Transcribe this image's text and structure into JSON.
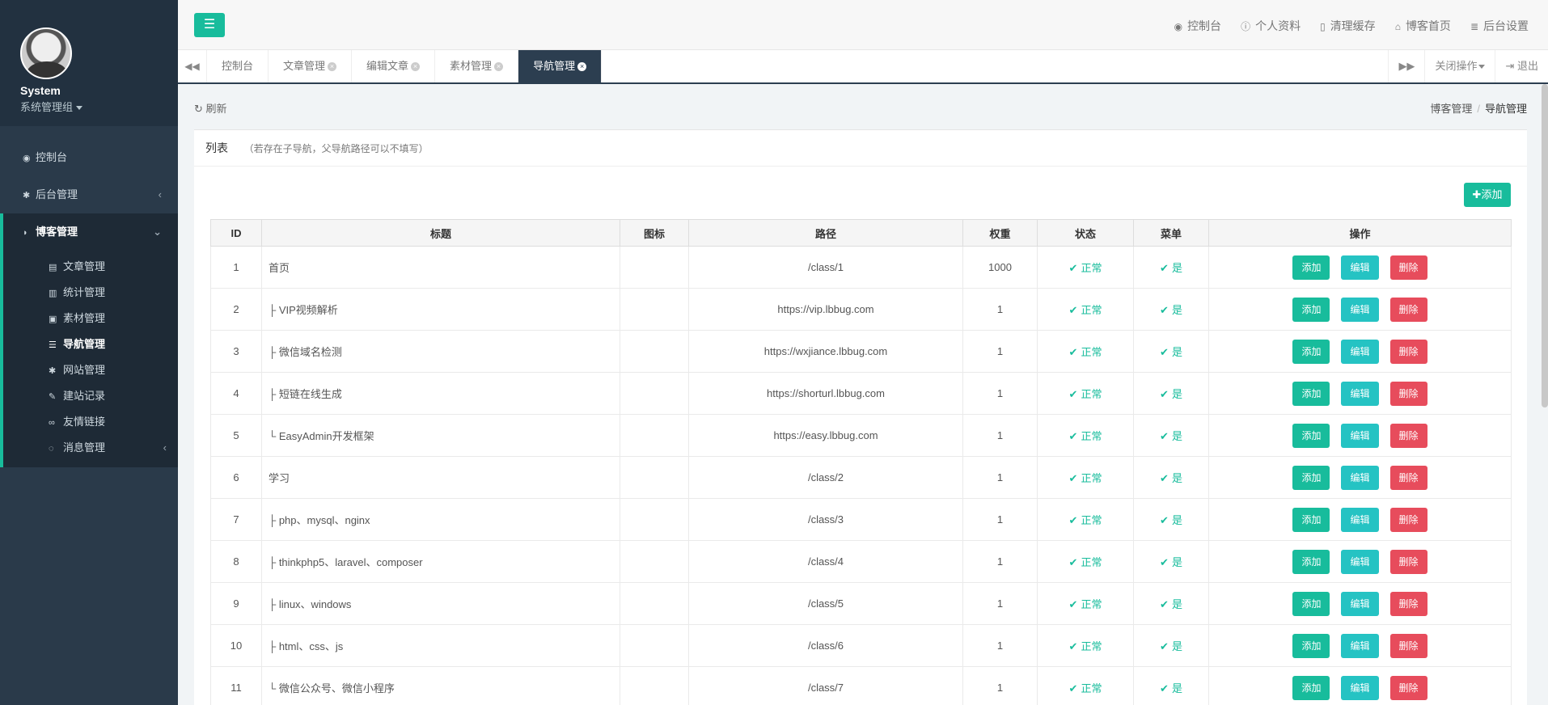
{
  "user": {
    "name": "System",
    "group": "系统管理组"
  },
  "menu": {
    "dashboard": "控制台",
    "admin": "后台管理",
    "blog": "博客管理",
    "sub": [
      "文章管理",
      "统计管理",
      "素材管理",
      "导航管理",
      "网站管理",
      "建站记录",
      "友情链接",
      "消息管理"
    ]
  },
  "header": {
    "links": [
      "控制台",
      "个人资料",
      "清理缓存",
      "博客首页",
      "后台设置"
    ]
  },
  "tabs": [
    "控制台",
    "文章管理",
    "编辑文章",
    "素材管理",
    "导航管理"
  ],
  "tabbar_right": {
    "close_ops": "关闭操作",
    "logout": "退出"
  },
  "content": {
    "refresh": "刷新",
    "breadcrumb": [
      "博客管理",
      "导航管理"
    ],
    "panel_title": "列表",
    "panel_note": "（若存在子导航，父导航路径可以不填写）",
    "add_button": "添加"
  },
  "table": {
    "columns": [
      "ID",
      "标题",
      "图标",
      "路径",
      "权重",
      "状态",
      "菜单",
      "操作"
    ],
    "actions": {
      "add": "添加",
      "edit": "编辑",
      "delete": "删除"
    },
    "rows": [
      {
        "id": "1",
        "title": "首页",
        "icon": "",
        "path": "/class/1",
        "weight": "1000",
        "status": "正常",
        "menu": "是"
      },
      {
        "id": "2",
        "title": "├ VIP视频解析",
        "icon": "",
        "path": "https://vip.lbbug.com",
        "weight": "1",
        "status": "正常",
        "menu": "是"
      },
      {
        "id": "3",
        "title": "├ 微信域名检测",
        "icon": "",
        "path": "https://wxjiance.lbbug.com",
        "weight": "1",
        "status": "正常",
        "menu": "是"
      },
      {
        "id": "4",
        "title": "├ 短链在线生成",
        "icon": "",
        "path": "https://shorturl.lbbug.com",
        "weight": "1",
        "status": "正常",
        "menu": "是"
      },
      {
        "id": "5",
        "title": "└ EasyAdmin开发框架",
        "icon": "",
        "path": "https://easy.lbbug.com",
        "weight": "1",
        "status": "正常",
        "menu": "是"
      },
      {
        "id": "6",
        "title": "学习",
        "icon": "",
        "path": "/class/2",
        "weight": "1",
        "status": "正常",
        "menu": "是"
      },
      {
        "id": "7",
        "title": "├ php、mysql、nginx",
        "icon": "",
        "path": "/class/3",
        "weight": "1",
        "status": "正常",
        "menu": "是"
      },
      {
        "id": "8",
        "title": "├ thinkphp5、laravel、composer",
        "icon": "",
        "path": "/class/4",
        "weight": "1",
        "status": "正常",
        "menu": "是"
      },
      {
        "id": "9",
        "title": "├ linux、windows",
        "icon": "",
        "path": "/class/5",
        "weight": "1",
        "status": "正常",
        "menu": "是"
      },
      {
        "id": "10",
        "title": "├ html、css、js",
        "icon": "",
        "path": "/class/6",
        "weight": "1",
        "status": "正常",
        "menu": "是"
      },
      {
        "id": "11",
        "title": "└ 微信公众号、微信小程序",
        "icon": "",
        "path": "/class/7",
        "weight": "1",
        "status": "正常",
        "menu": "是"
      }
    ]
  },
  "colors": {
    "primary": "#18bc9c",
    "info": "#25c3c3",
    "danger": "#e74c5c",
    "sidebar": "#2a3a4a",
    "tab_active": "#2c3e50"
  }
}
